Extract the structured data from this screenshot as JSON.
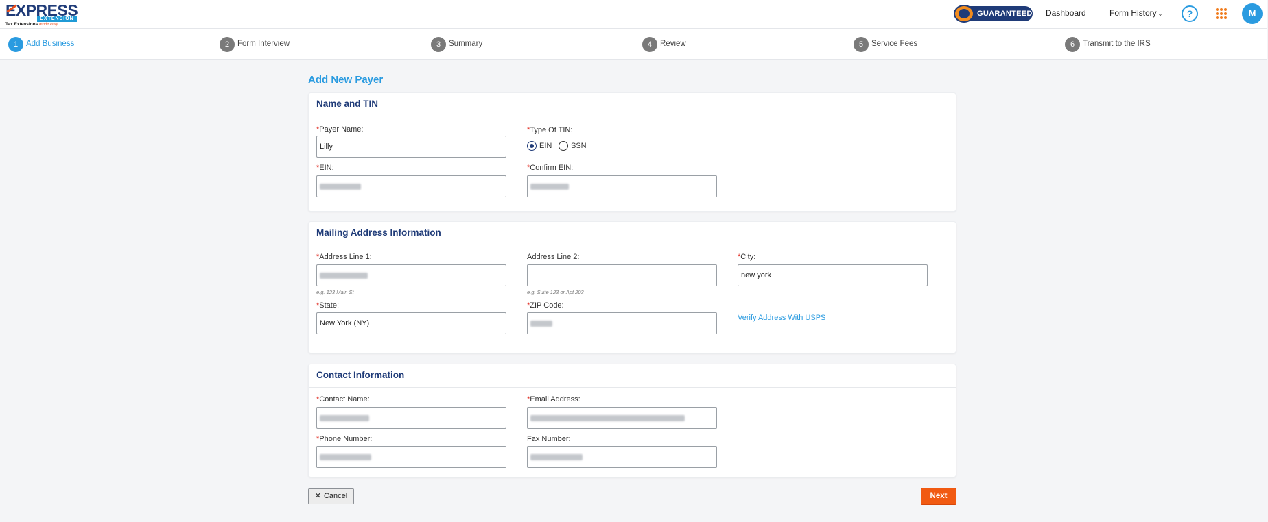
{
  "header": {
    "logo": {
      "word": "EXPRESS",
      "bar": "EXTENSION",
      "tagline": "Tax Extensions",
      "tagline_accent": "made easy"
    },
    "badge": "GUARANTEED",
    "nav": {
      "dashboard": "Dashboard",
      "form_history": "Form History"
    },
    "help_symbol": "?",
    "avatar_initial": "M"
  },
  "steps": [
    {
      "num": "1",
      "label": "Add Business",
      "active": true
    },
    {
      "num": "2",
      "label": "Form Interview",
      "active": false
    },
    {
      "num": "3",
      "label": "Summary",
      "active": false
    },
    {
      "num": "4",
      "label": "Review",
      "active": false
    },
    {
      "num": "5",
      "label": "Service Fees",
      "active": false
    },
    {
      "num": "6",
      "label": "Transmit to the IRS",
      "active": false
    }
  ],
  "page_title": "Add New Payer",
  "name_tin": {
    "heading": "Name and TIN",
    "payer_name": {
      "label": "Payer Name:",
      "value": "Lilly"
    },
    "type_of_tin": {
      "label": "Type Of TIN:",
      "options": [
        "EIN",
        "SSN"
      ],
      "selected": "EIN"
    },
    "ein": {
      "label": "EIN:"
    },
    "confirm_ein": {
      "label": "Confirm EIN:"
    }
  },
  "mailing": {
    "heading": "Mailing Address Information",
    "address1": {
      "label": "Address Line 1:",
      "hint": "e.g. 123 Main St"
    },
    "address2": {
      "label": "Address Line 2:",
      "hint": "e.g. Suite 123 or Apt 203"
    },
    "city": {
      "label": "City:",
      "value": "new york"
    },
    "state": {
      "label": "State:",
      "value": "New York (NY)"
    },
    "zip": {
      "label": "ZIP Code:"
    },
    "verify_link": "Verify Address With USPS"
  },
  "contact": {
    "heading": "Contact Information",
    "contact_name": {
      "label": "Contact Name:"
    },
    "email": {
      "label": "Email Address:"
    },
    "phone": {
      "label": "Phone Number:"
    },
    "fax": {
      "label": "Fax Number:"
    }
  },
  "actions": {
    "cancel": "Cancel",
    "next": "Next"
  },
  "colors": {
    "primary_blue": "#2a9be0",
    "navy": "#1f3b78",
    "accent_orange": "#f15a12",
    "required_red": "#e0261b"
  }
}
